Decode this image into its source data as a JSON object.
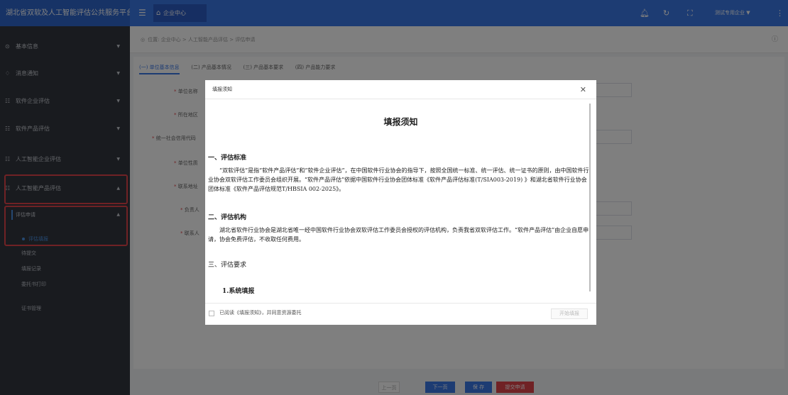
{
  "app": {
    "title": "湖北省双软及人工智能评估公共服务平台"
  },
  "topbar": {
    "menu_icon": "menu-icon",
    "home_tab": "企业中心",
    "user": "测试专用企业 ▼"
  },
  "sidebar": {
    "items": [
      {
        "label": "基本信息"
      },
      {
        "label": "消息通知"
      },
      {
        "label": "软件企业评估"
      },
      {
        "label": "软件产品评估"
      },
      {
        "label": "人工智能企业评估"
      },
      {
        "label": "人工智能产品评估"
      }
    ],
    "sub_label": "评估申请",
    "subsub": [
      "评估填报",
      "待提交",
      "填报记录",
      "委托书打印"
    ],
    "certificate": "证书管理"
  },
  "breadcrumb": {
    "text": "位置: 企业中心 > 人工智能产品评估 > 评估申请"
  },
  "tabs": [
    "(一) 单位基本信息",
    "(二) 产品基本情况",
    "(三) 产品基本要求",
    "(四) 产品能力要求"
  ],
  "form": {
    "labels": [
      "单位名称",
      "所在地区",
      "统一社会信用代码",
      "单位性质",
      "联系地址",
      "负责人",
      "联系人"
    ]
  },
  "footer": {
    "prev": "上一页",
    "next": "下一页",
    "save": "保 存",
    "submit": "提交申请"
  },
  "modal": {
    "header": "填报须知",
    "title": "填报须知",
    "s1_heading": "一、评估标准",
    "s1_text": "“双软评估”是指“软件产品评估”和“软件企业评估”，在中国软件行业协会的指导下，按照全国统一标准、统一评估、统一证书的原则，由中国软件行业协会双软评估工作委员会组织开展。“软件产品评估”依据中国软件行业协会团体标准《软件产品评估标准(T/SIA003-2019) 》和湖北省软件行业协会团体标准《软件产品评估规范T/HBSIA 002-2025》。",
    "s2_heading": "二、评估机构",
    "s2_text": "湖北省软件行业协会是湖北省唯一经中国软件行业协会双软评估工作委员会授权的评估机构，负责我省双软评估工作。“软件产品评估”由企业自愿申请，协会免费评估，不收取任何费用。",
    "s3_heading": "三、评估要求",
    "s3_sub": "1.系统填报",
    "agree": "已阅读《填报须知》，并同意资源委托",
    "start": "开始填报"
  },
  "colors": {
    "topbar": "#3b78e7",
    "sidebar": "#32363f",
    "highlight": "#e0454b",
    "next_btn": "#3b78e7",
    "save_btn": "#3b78e7",
    "submit_btn": "#e0454b"
  }
}
